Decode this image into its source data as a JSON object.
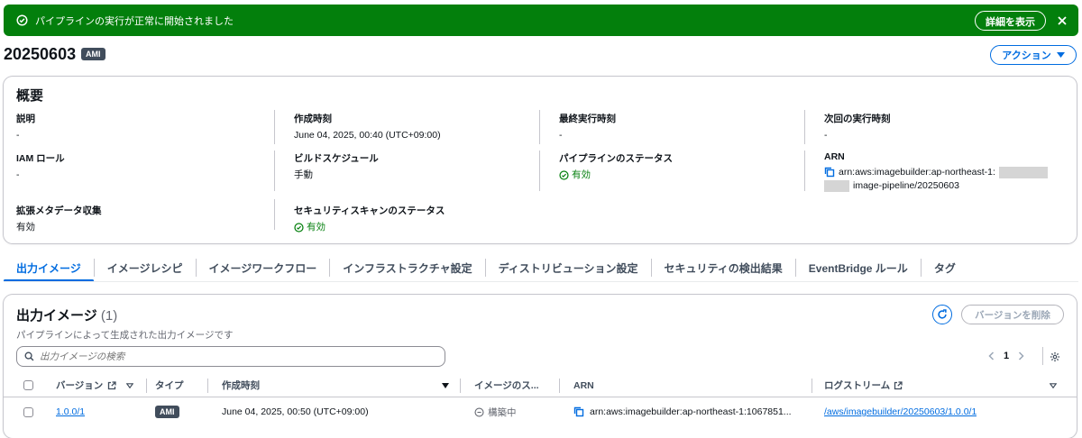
{
  "flash": {
    "message": "パイプラインの実行が正常に開始されました",
    "detail_button": "詳細を表示"
  },
  "header": {
    "title": "20250603",
    "badge": "AMI",
    "action_button": "アクション"
  },
  "overview": {
    "title": "概要",
    "fields": {
      "description": {
        "label": "説明",
        "value": "-"
      },
      "created": {
        "label": "作成時刻",
        "value": "June 04, 2025, 00:40 (UTC+09:00)"
      },
      "last_run": {
        "label": "最終実行時刻",
        "value": "-"
      },
      "next_run": {
        "label": "次回の実行時刻",
        "value": "-"
      },
      "iam_role": {
        "label": "IAM ロール",
        "value": "-"
      },
      "build_schedule": {
        "label": "ビルドスケジュール",
        "value": "手動"
      },
      "pipeline_status": {
        "label": "パイプラインのステータス",
        "value": "有効"
      },
      "arn": {
        "label": "ARN",
        "value_line1": "arn:aws:imagebuilder:ap-northeast-1:",
        "value_line2": "image-pipeline/20250603"
      },
      "enhanced_metadata": {
        "label": "拡張メタデータ収集",
        "value": "有効"
      },
      "security_scan": {
        "label": "セキュリティスキャンのステータス",
        "value": "有効"
      }
    }
  },
  "tabs": [
    {
      "label": "出力イメージ",
      "active": true
    },
    {
      "label": "イメージレシピ"
    },
    {
      "label": "イメージワークフロー"
    },
    {
      "label": "インフラストラクチャ設定"
    },
    {
      "label": "ディストリビューション設定"
    },
    {
      "label": "セキュリティの検出結果"
    },
    {
      "label": "EventBridge ルール"
    },
    {
      "label": "タグ"
    }
  ],
  "output_images": {
    "title": "出力イメージ",
    "count": "(1)",
    "description": "パイプラインによって生成された出力イメージです",
    "delete_button": "バージョンを削除",
    "search_placeholder": "出力イメージの検索",
    "page": "1",
    "columns": {
      "version": "バージョン",
      "type": "タイプ",
      "created": "作成時刻",
      "image_status": "イメージのス...",
      "arn": "ARN",
      "log_stream": "ログストリーム"
    },
    "rows": [
      {
        "version": "1.0.0/1",
        "type": "AMI",
        "created": "June 04, 2025, 00:50 (UTC+09:00)",
        "status": "構築中",
        "arn": "arn:aws:imagebuilder:ap-northeast-1:1067851...",
        "log_stream": "/aws/imagebuilder/20250603/1.0.0/1"
      }
    ]
  },
  "colors": {
    "success": "#037f0c",
    "link": "#006ce0",
    "badge": "#414d5c"
  }
}
